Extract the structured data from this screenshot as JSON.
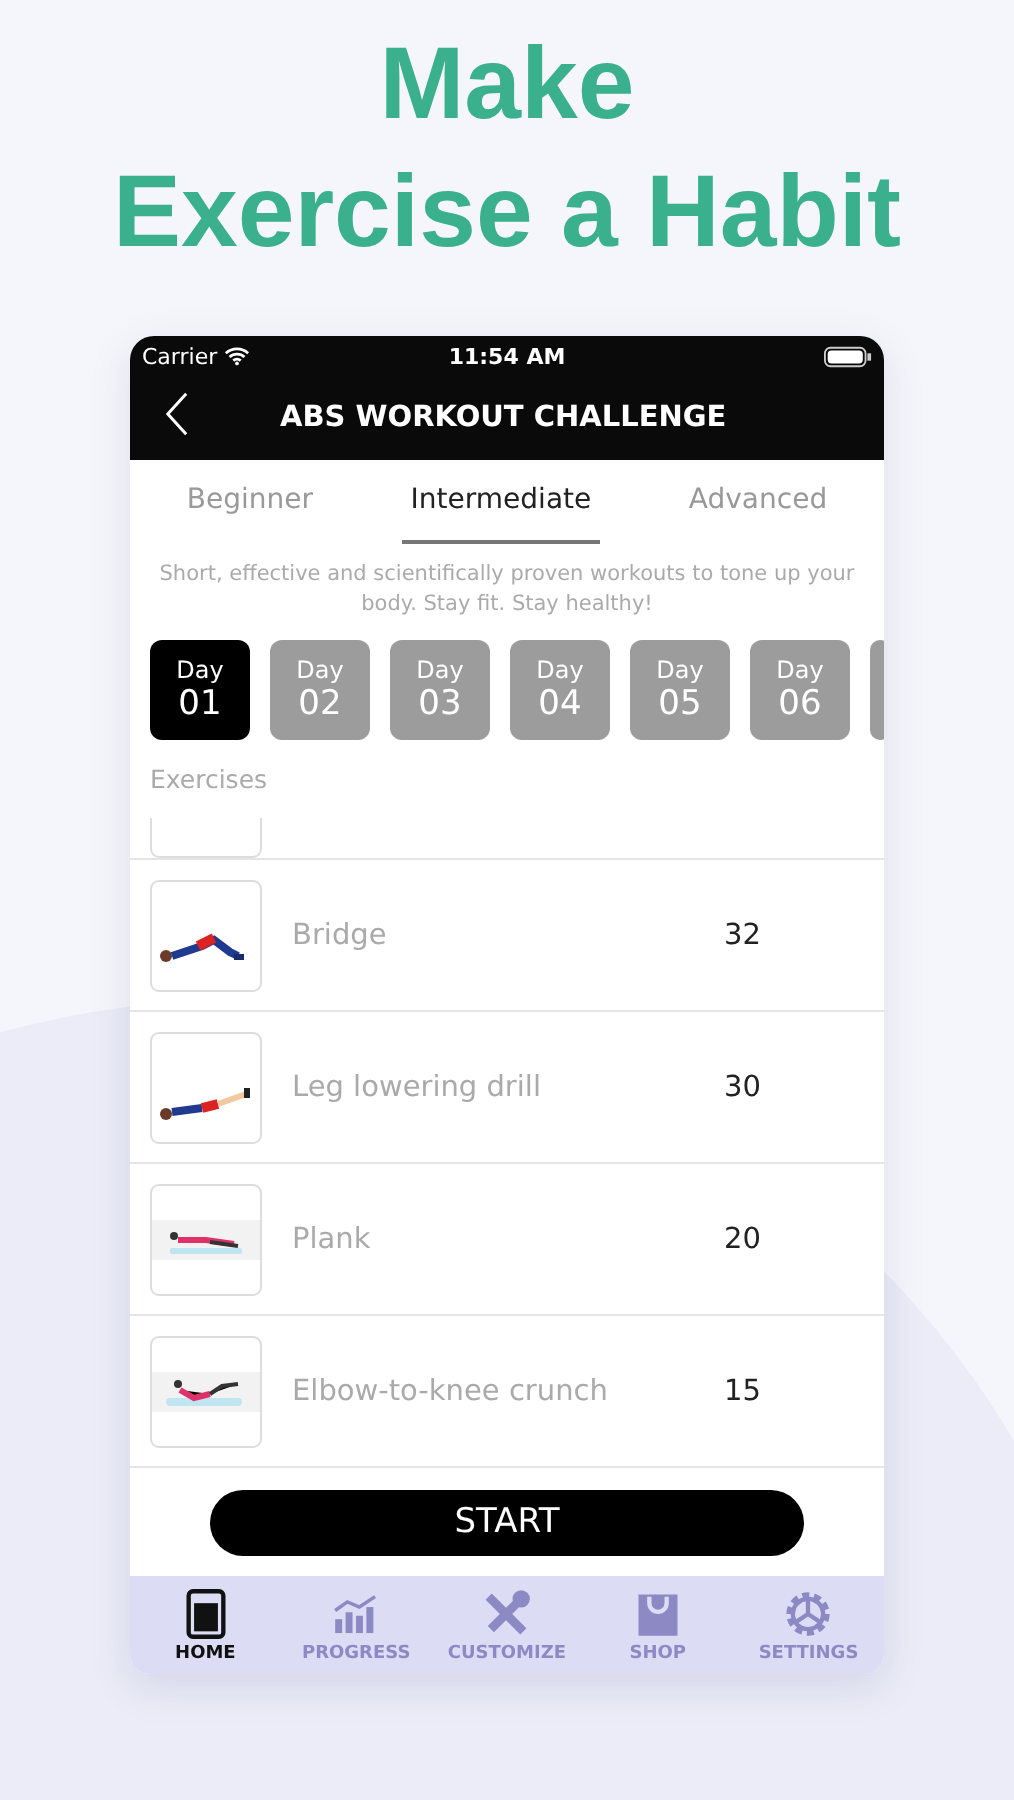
{
  "headline": [
    "Make",
    "Exercise a Habit"
  ],
  "status_bar": {
    "carrier": "Carrier",
    "time": "11:54 AM"
  },
  "nav_bar": {
    "title": "ABS WORKOUT CHALLENGE"
  },
  "tabs": [
    {
      "label": "Beginner",
      "selected": false
    },
    {
      "label": "Intermediate",
      "selected": true
    },
    {
      "label": "Advanced",
      "selected": false
    }
  ],
  "description": "Short, effective and scientifically proven workouts to tone up your body. Stay fit. Stay healthy!",
  "days": [
    {
      "label": "Day",
      "number": "01",
      "selected": true
    },
    {
      "label": "Day",
      "number": "02",
      "selected": false
    },
    {
      "label": "Day",
      "number": "03",
      "selected": false
    },
    {
      "label": "Day",
      "number": "04",
      "selected": false
    },
    {
      "label": "Day",
      "number": "05",
      "selected": false
    },
    {
      "label": "Day",
      "number": "06",
      "selected": false
    }
  ],
  "section_title": "Exercises",
  "exercises": [
    {
      "name": "Bridge",
      "count": "32"
    },
    {
      "name": "Leg lowering drill",
      "count": "30"
    },
    {
      "name": "Plank",
      "count": "20"
    },
    {
      "name": "Elbow-to-knee crunch",
      "count": "15"
    }
  ],
  "start_button": "START",
  "tab_bar": [
    {
      "label": "HOME",
      "selected": true
    },
    {
      "label": "PROGRESS",
      "selected": false
    },
    {
      "label": "CUSTOMIZE",
      "selected": false
    },
    {
      "label": "SHOP",
      "selected": false
    },
    {
      "label": "SETTINGS",
      "selected": false
    }
  ]
}
